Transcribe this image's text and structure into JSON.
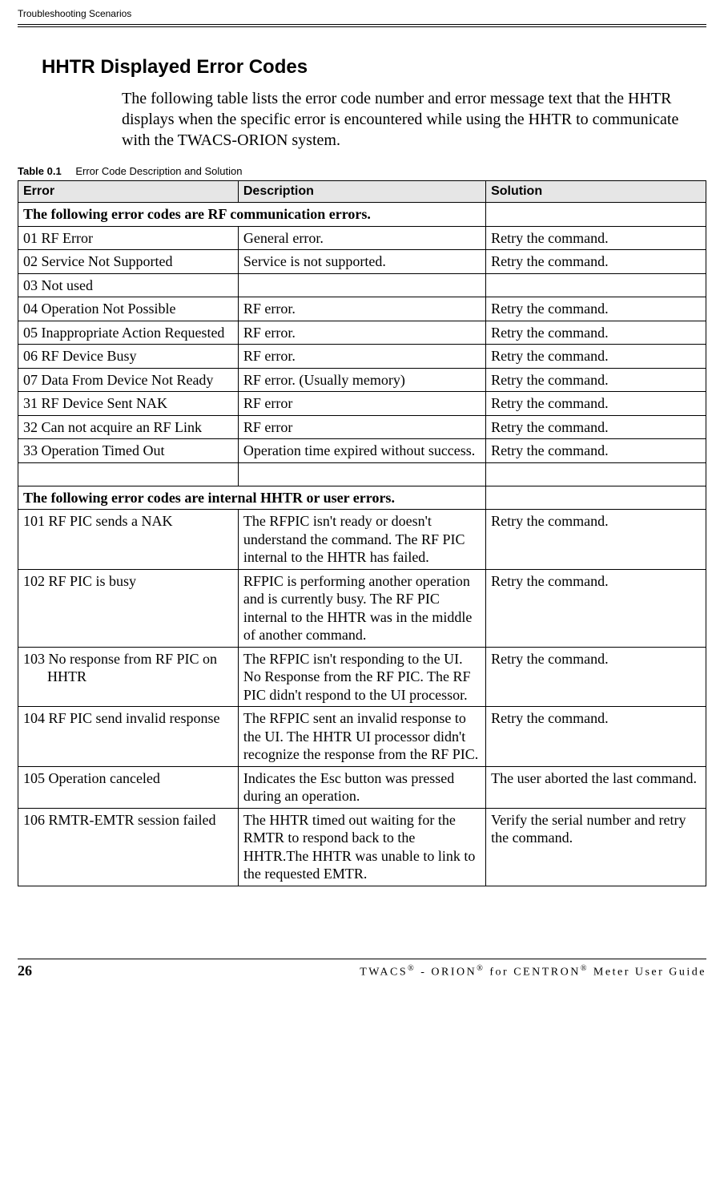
{
  "header": {
    "running": "Troubleshooting Scenarios"
  },
  "section": {
    "title": "HHTR Displayed Error Codes",
    "intro": "The following table lists the error code number and error message text that the HHTR displays when the specific error is encountered while using the HHTR to communicate with the TWACS-ORION system."
  },
  "table": {
    "caption_num": "Table 0.1",
    "caption_text": "Error Code Description and Solution",
    "headers": {
      "c1": "Error",
      "c2": "Description",
      "c3": "Solution"
    },
    "section1": "The following error codes are RF communication errors.",
    "section2": "The following error codes are internal HHTR or user errors.",
    "rows_rf": [
      {
        "err": "01 RF Error",
        "desc": "General error.",
        "sol": "Retry the command."
      },
      {
        "err": "02 Service Not Supported",
        "desc": "Service is not supported.",
        "sol": "Retry the command."
      },
      {
        "err": "03 Not used",
        "desc": "",
        "sol": ""
      },
      {
        "err": "04 Operation Not Possible",
        "desc": "RF error.",
        "sol": "Retry the command."
      },
      {
        "err": "05 Inappropriate Action Requested",
        "desc": "RF error.",
        "sol": "Retry the command."
      },
      {
        "err": "06 RF Device Busy",
        "desc": "RF error.",
        "sol": "Retry the command."
      },
      {
        "err": "07 Data From Device Not Ready",
        "desc": "RF error. (Usually memory)",
        "sol": "Retry the command."
      },
      {
        "err": "31 RF Device Sent NAK",
        "desc": "RF error",
        "sol": "Retry the command."
      },
      {
        "err": "32 Can not acquire an RF Link",
        "desc": "RF error",
        "sol": "Retry the command."
      },
      {
        "err": "33 Operation Timed Out",
        "desc": "Operation time expired without success.",
        "sol": "Retry the command."
      }
    ],
    "rows_int": [
      {
        "err": "101 RF PIC sends a NAK",
        "desc": "The RFPIC isn't ready or doesn't understand the command. The RF PIC internal to the HHTR has failed.",
        "sol": " Retry the command."
      },
      {
        "err": "102 RF PIC is busy",
        "desc": "RFPIC is performing another operation and is currently busy. The RF PIC internal to the HHTR was in the middle of another command.",
        "sol": " Retry the command."
      },
      {
        "err": "103 No response from RF PIC on HHTR",
        "desc": "The RFPIC isn't responding to the UI. No Response from the RF PIC. The RF PIC didn't respond to the UI processor.",
        "sol": " Retry the command."
      },
      {
        "err": "104 RF PIC send invalid response",
        "desc": "The RFPIC sent an invalid response to the UI. The HHTR UI processor didn't recognize the response from the RF PIC.",
        "sol": " Retry the command."
      },
      {
        "err": "105 Operation canceled",
        "desc": "Indicates the Esc button was pressed during an operation.",
        "sol": "The user aborted the last command."
      },
      {
        "err": "106 RMTR-EMTR session failed",
        "desc": "The HHTR timed out waiting for the RMTR to respond back to the HHTR.The HHTR was unable to link to the requested EMTR.",
        "sol": "Verify the serial number and retry the command."
      }
    ]
  },
  "footer": {
    "page": "26",
    "title_pre": "TWACS",
    "title_mid1": " - ORION",
    "title_mid2": " for CENTRON",
    "title_post": " Meter User Guide",
    "reg": "®"
  }
}
